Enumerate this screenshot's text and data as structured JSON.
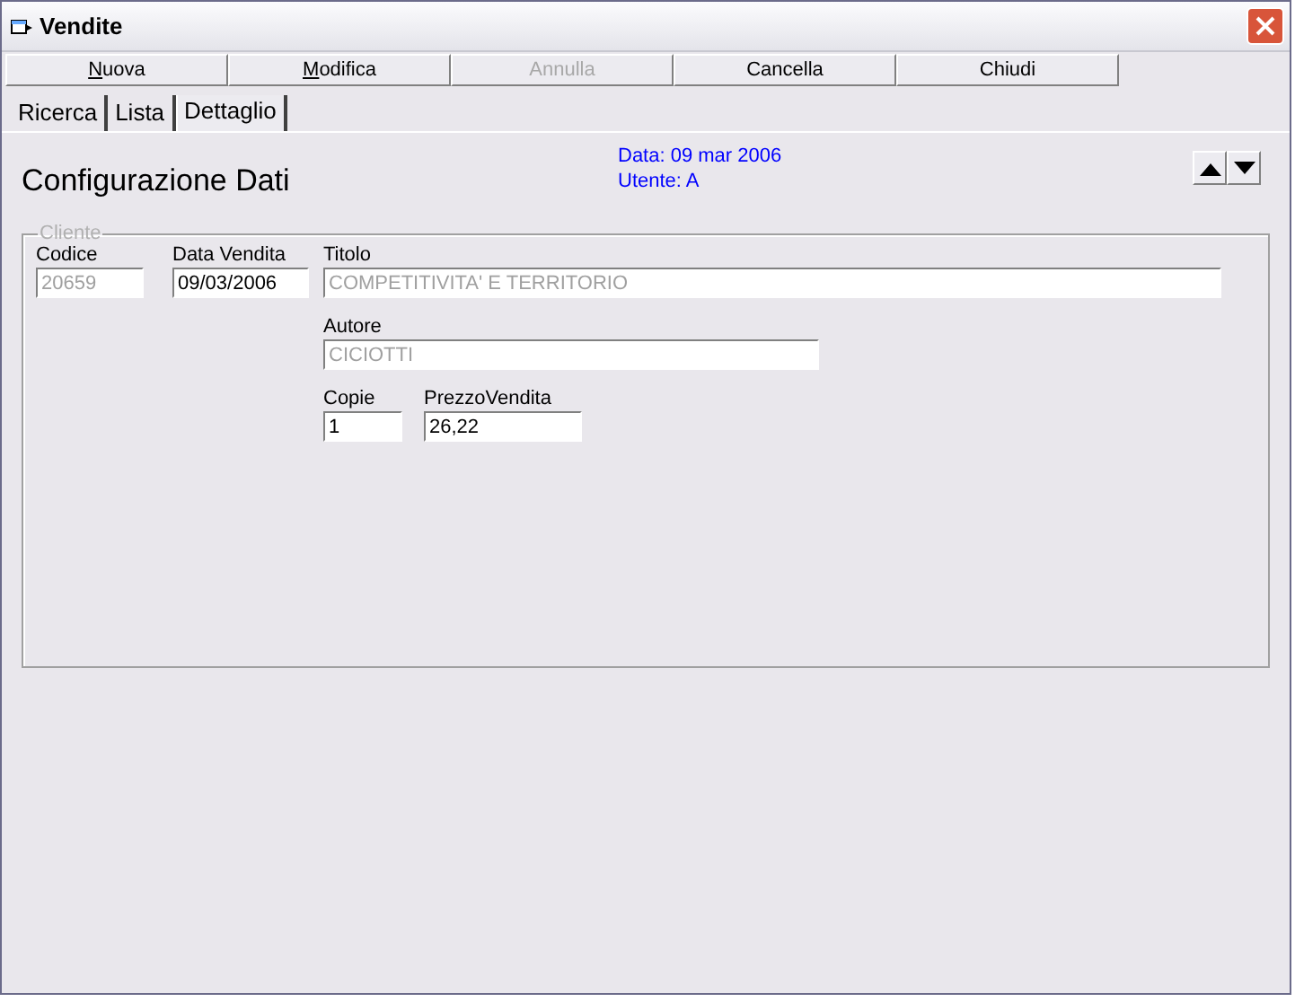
{
  "window": {
    "title": "Vendite"
  },
  "toolbar": [
    {
      "label": "Nuova",
      "mnemonic": true,
      "disabled": false
    },
    {
      "label": "Modifica",
      "mnemonic": true,
      "disabled": false
    },
    {
      "label": "Annulla",
      "mnemonic": false,
      "disabled": true
    },
    {
      "label": "Cancella",
      "mnemonic": false,
      "disabled": false
    },
    {
      "label": "Chiudi",
      "mnemonic": false,
      "disabled": false
    }
  ],
  "tabs": [
    {
      "label": "Ricerca",
      "selected": false
    },
    {
      "label": "Lista",
      "selected": false
    },
    {
      "label": "Dettaglio",
      "selected": true
    }
  ],
  "heading": "Configurazione Dati",
  "info": [
    "Data: 09 mar 2006",
    "Utente: A"
  ],
  "group": {
    "legend": "Cliente",
    "disabled": true,
    "fields": [
      {
        "label": "Codice",
        "value": "20659",
        "disabled": true
      },
      {
        "label": "Data Vendita",
        "value": "09/03/2006",
        "disabled": false
      },
      {
        "label": "Titolo",
        "value": "COMPETITIVITA' E TERRITORIO",
        "disabled": true
      },
      {
        "label": "Autore",
        "value": "CICIOTTI",
        "disabled": true
      },
      {
        "label": "Copie",
        "value": "1",
        "disabled": false
      },
      {
        "label": "PrezzoVendita",
        "value": "26,22",
        "disabled": false
      }
    ]
  }
}
